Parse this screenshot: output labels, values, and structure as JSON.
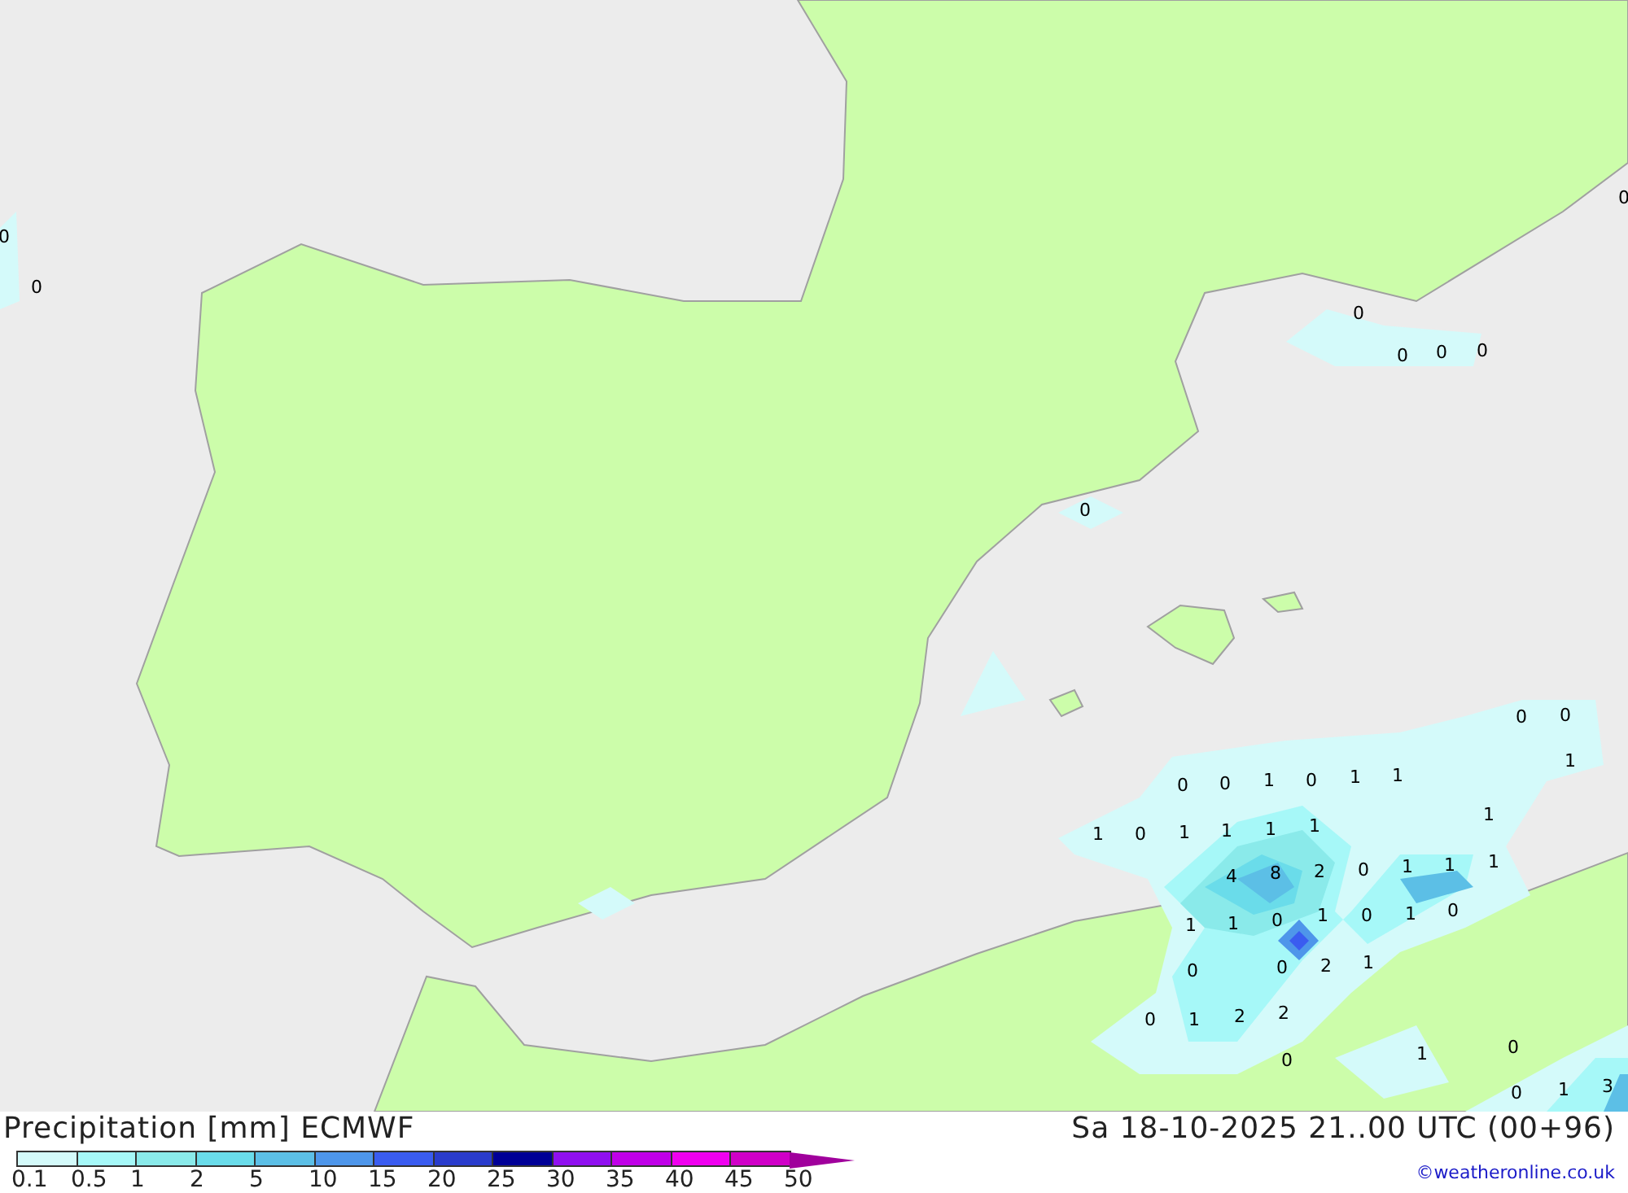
{
  "map": {
    "value_labels": [
      "0",
      "0",
      "0",
      "0",
      "0",
      "0",
      "0",
      "0",
      "0",
      "0",
      "1",
      "0",
      "0",
      "1",
      "0",
      "1",
      "1",
      "1",
      "0",
      "1",
      "1",
      "1",
      "1",
      "1",
      "4",
      "8",
      "2",
      "0",
      "1",
      "1",
      "1",
      "1",
      "1",
      "0",
      "1",
      "0",
      "1",
      "0",
      "0",
      "0",
      "2",
      "1",
      "0",
      "1",
      "2",
      "2",
      "0",
      "1",
      "0",
      "0",
      "1",
      "3"
    ]
  },
  "legend": {
    "title": "Precipitation [mm] ECMWF",
    "levels": [
      {
        "label": "0.1",
        "color": "#d4fafa"
      },
      {
        "label": "0.5",
        "color": "#a6f8f8"
      },
      {
        "label": "1",
        "color": "#8aeaea"
      },
      {
        "label": "2",
        "color": "#6adcea"
      },
      {
        "label": "5",
        "color": "#5cbfe6"
      },
      {
        "label": "10",
        "color": "#4e96ea"
      },
      {
        "label": "15",
        "color": "#3a5cf0"
      },
      {
        "label": "20",
        "color": "#2a3ccc"
      },
      {
        "label": "25",
        "color": "#000096"
      },
      {
        "label": "30",
        "color": "#9010f0"
      },
      {
        "label": "35",
        "color": "#c000e8"
      },
      {
        "label": "40",
        "color": "#f000f0"
      },
      {
        "label": "45",
        "color": "#d000c8"
      },
      {
        "label": "50",
        "color": "#a0009c"
      }
    ]
  },
  "valid_time": "Sa 18-10-2025 21..00 UTC (00+96)",
  "credit": "©weatheronline.co.uk"
}
